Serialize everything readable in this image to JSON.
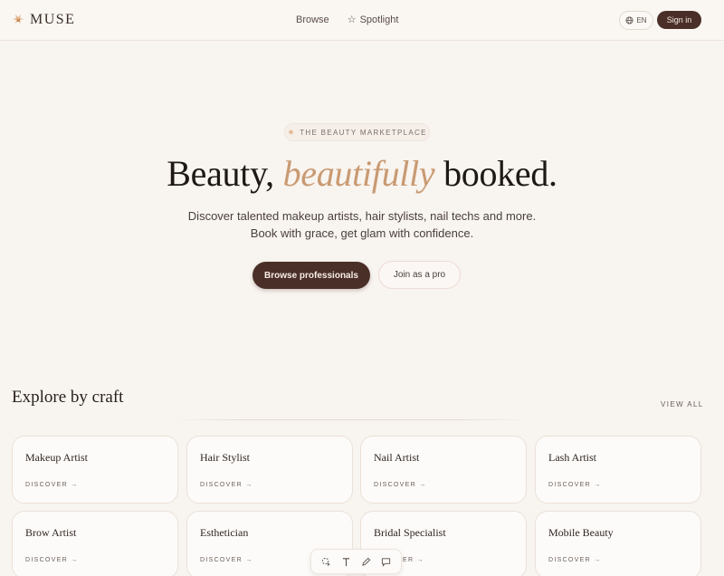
{
  "header": {
    "brand": "MUSE",
    "nav": [
      {
        "label": "Browse",
        "icon": null
      },
      {
        "label": "Spotlight",
        "icon": "star-icon"
      }
    ],
    "lang": "EN",
    "signin": "Sign in"
  },
  "hero": {
    "badge": "THE BEAUTY MARKETPLACE",
    "title_pre": "Beauty,",
    "title_em": "beautifully",
    "title_post": "booked.",
    "sub1": "Discover talented makeup artists, hair stylists, nail techs and more.",
    "sub2": "Book with grace, get glam with confidence.",
    "primary": "Browse professionals",
    "secondary": "Join as a pro"
  },
  "explore": {
    "title": "Explore by craft",
    "view_all": "VIEW ALL",
    "cards": [
      {
        "title": "Makeup Artist",
        "link": "DISCOVER →"
      },
      {
        "title": "Hair Stylist",
        "link": "DISCOVER →"
      },
      {
        "title": "Nail Artist",
        "link": "DISCOVER →"
      },
      {
        "title": "Lash Artist",
        "link": "DISCOVER →"
      },
      {
        "title": "Brow Artist",
        "link": "DISCOVER →"
      },
      {
        "title": "Esthetician",
        "link": "DISCOVER →"
      },
      {
        "title": "Bridal Specialist",
        "link": "ER →"
      },
      {
        "title": "Mobile Beauty",
        "link": "DISCOVER →"
      }
    ]
  },
  "colors": {
    "accent": "#c99a72",
    "primary": "#4a2f28",
    "background": "#f8f4f0"
  },
  "toolbar": {
    "tools": [
      "select-icon",
      "text-icon",
      "pen-icon",
      "comment-icon"
    ]
  }
}
